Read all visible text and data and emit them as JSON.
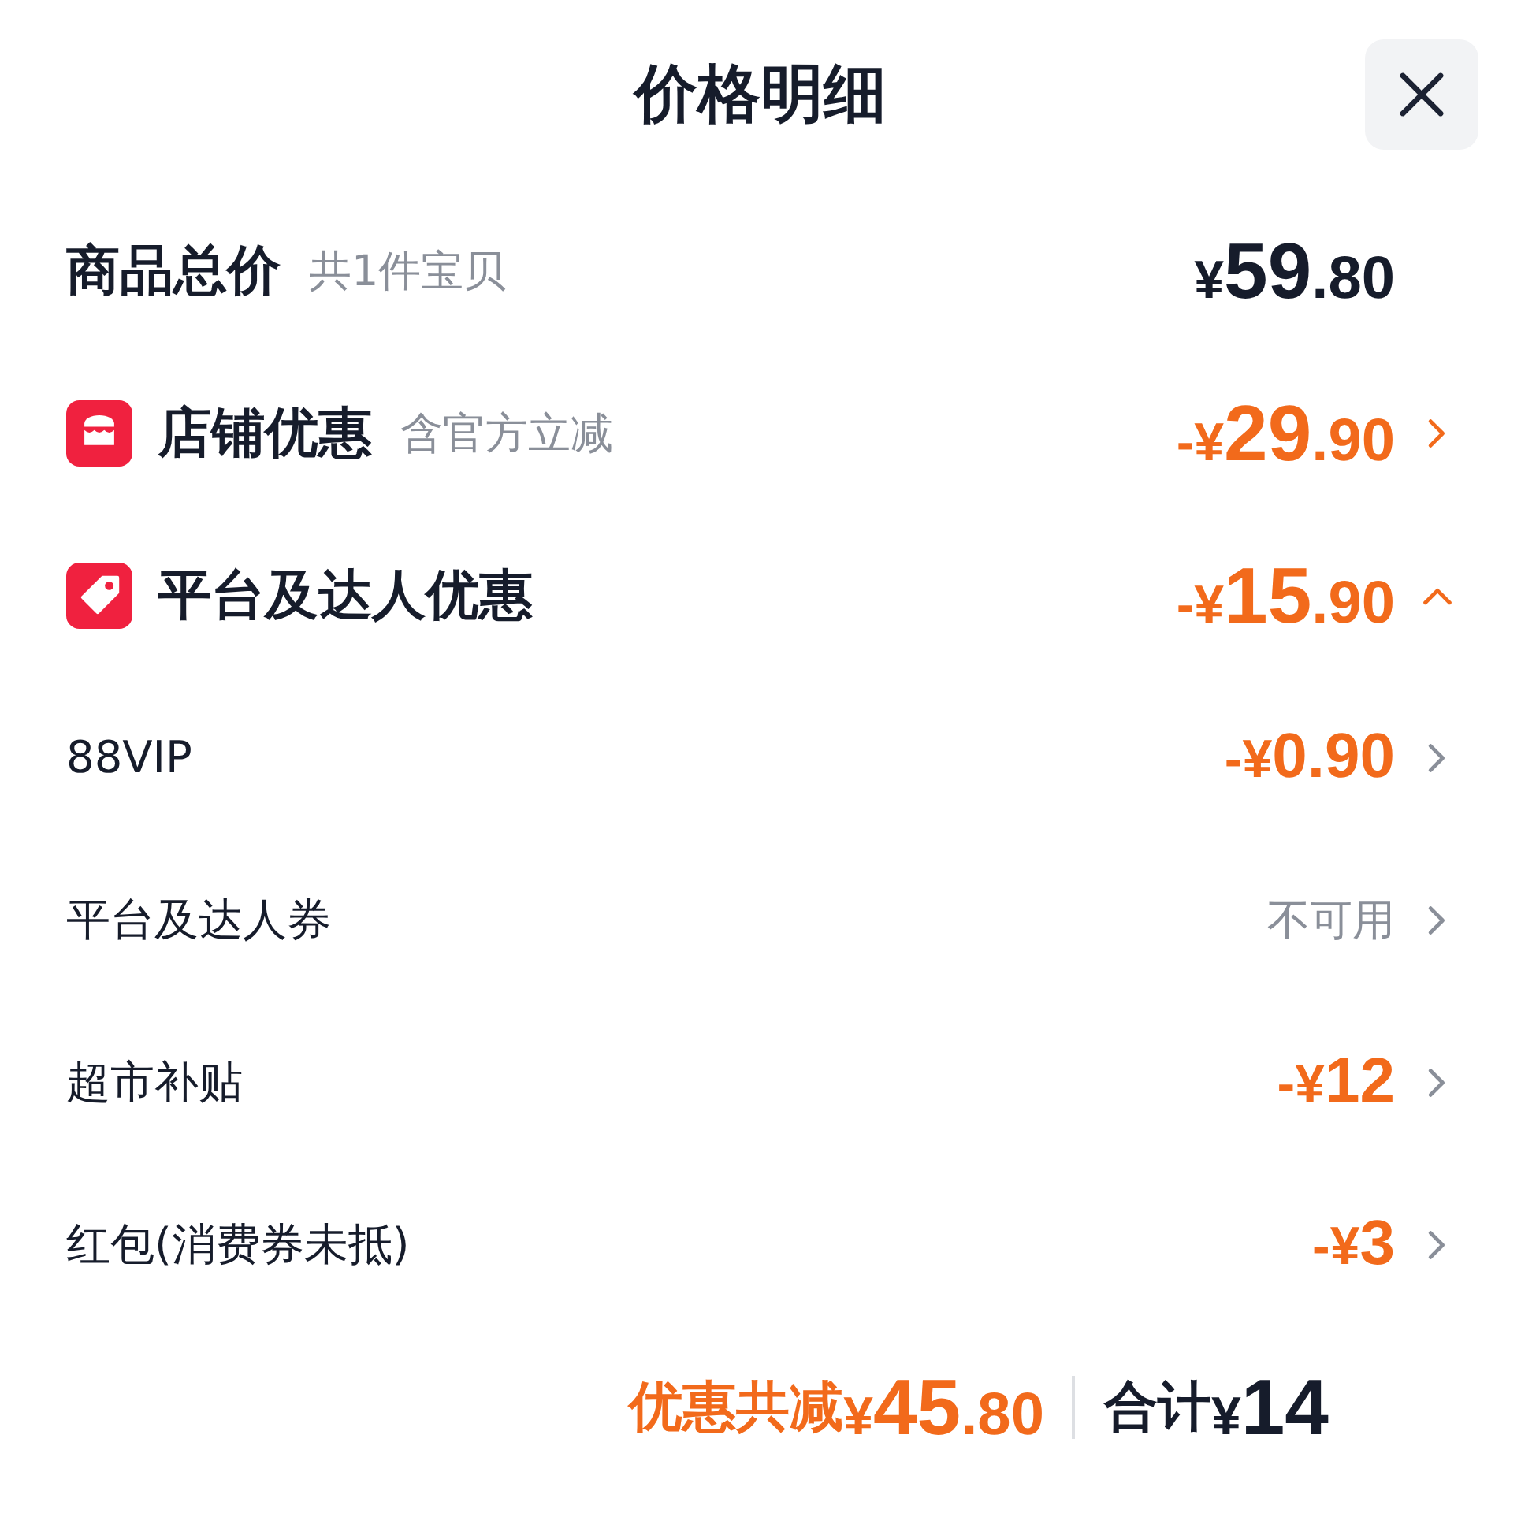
{
  "header": {
    "title": "价格明细"
  },
  "total": {
    "label": "商品总价",
    "note": "共1件宝贝",
    "price": {
      "sign": "¥",
      "whole": "59",
      "cents": ".80"
    }
  },
  "sections": [
    {
      "kind": "store",
      "label": "店铺优惠",
      "note": "含官方立减",
      "expanded": false,
      "price": {
        "sign": "-¥",
        "whole": "29",
        "cents": ".90"
      }
    },
    {
      "kind": "tag",
      "label": "平台及达人优惠",
      "expanded": true,
      "price": {
        "sign": "-¥",
        "whole": "15",
        "cents": ".90"
      },
      "items": [
        {
          "kind": "price",
          "label": "88VIP",
          "price": {
            "sign": "-¥",
            "whole": "0",
            "cents": ".90"
          }
        },
        {
          "kind": "text",
          "label": "平台及达人券",
          "value": "不可用"
        },
        {
          "kind": "price",
          "label": "超市补贴",
          "price": {
            "sign": "-¥",
            "whole": "12"
          }
        },
        {
          "kind": "price",
          "label": "红包(消费券未抵)",
          "price": {
            "sign": "-¥",
            "whole": "3"
          }
        }
      ]
    }
  ],
  "footer": {
    "discount_label": "优惠共减",
    "discount": {
      "sign": "¥",
      "whole": "45",
      "cents": ".80"
    },
    "sum_label": "合计",
    "sum": {
      "sign": "¥",
      "whole": "14"
    }
  }
}
